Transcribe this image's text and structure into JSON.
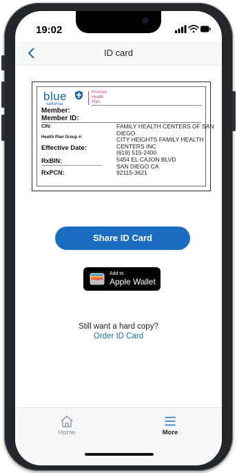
{
  "status_bar": {
    "time": "19:02"
  },
  "header": {
    "title": "ID card",
    "back_icon": "chevron-left-icon"
  },
  "id_card": {
    "logo": {
      "wordmark": "blue",
      "sub": "california",
      "partner_lines": [
        "Promise",
        "Health",
        "Plan"
      ]
    },
    "labels": {
      "member": "Member:",
      "member_id": "Member ID:",
      "cin": "CIN:",
      "group": "Health Plan Group #:",
      "effective": "Effective Date:",
      "rxbin": "RxBIN:",
      "rxpcn": "RxPCN:"
    },
    "address_lines": [
      "FAMILY HEALTH CENTERS OF SAN",
      "DIEGO",
      "CITY HEIGHTS FAMILY HEALTH",
      "CENTERS INC",
      "(619) 515-2400",
      "5454 EL CAJON BLVD",
      "SAN DIEGO CA",
      "92115-3621"
    ]
  },
  "actions": {
    "share_label": "Share ID Card",
    "wallet_add": "Add to",
    "wallet_name": "Apple Wallet",
    "hardcopy_prompt": "Still want a hard copy?",
    "order_label": "Order ID Card"
  },
  "tabs": [
    {
      "label": "Home",
      "icon": "home-icon",
      "active": false
    },
    {
      "label": "More",
      "icon": "menu-icon",
      "active": true
    }
  ],
  "colors": {
    "accent": "#1a6dc0",
    "brand_blue": "#1a5fa8",
    "brand_pink": "#c63c7c"
  }
}
